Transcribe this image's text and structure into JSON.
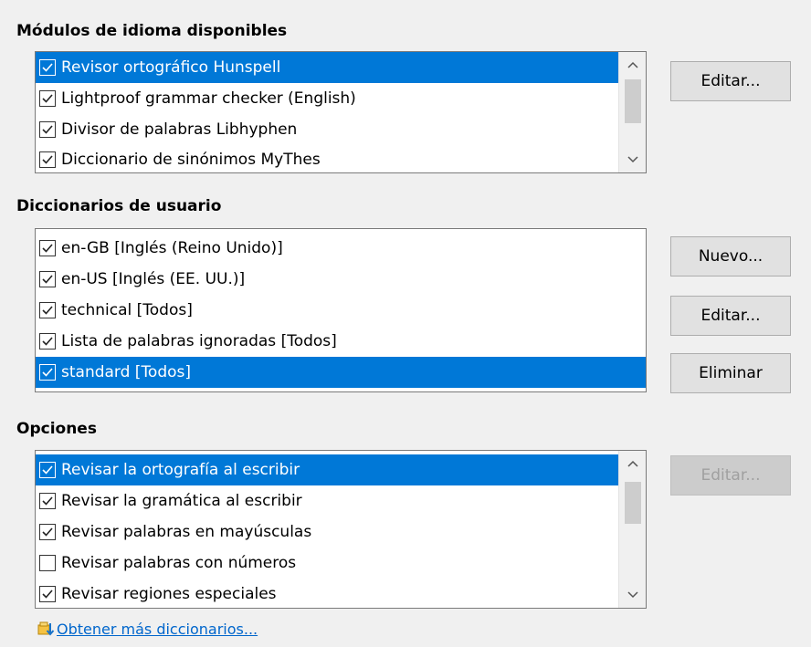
{
  "modules": {
    "title": "Módulos de idioma disponibles",
    "items": [
      {
        "label": "Revisor ortográfico Hunspell",
        "checked": true,
        "selected": true
      },
      {
        "label": "Lightproof grammar checker (English)",
        "checked": true,
        "selected": false
      },
      {
        "label": "Divisor de palabras Libhyphen",
        "checked": true,
        "selected": false
      },
      {
        "label": "Diccionario de sinónimos MyThes",
        "checked": true,
        "selected": false
      }
    ],
    "edit_label": "Editar..."
  },
  "user_dicts": {
    "title": "Diccionarios de usuario",
    "items": [
      {
        "label": "en-GB [Inglés (Reino Unido)]",
        "checked": true,
        "selected": false
      },
      {
        "label": "en-US [Inglés (EE. UU.)]",
        "checked": true,
        "selected": false
      },
      {
        "label": "technical [Todos]",
        "checked": true,
        "selected": false
      },
      {
        "label": "Lista de palabras ignoradas [Todos]",
        "checked": true,
        "selected": false
      },
      {
        "label": "standard [Todos]",
        "checked": true,
        "selected": true
      }
    ],
    "new_label": "Nuevo...",
    "edit_label": "Editar...",
    "delete_label": "Eliminar"
  },
  "options": {
    "title": "Opciones",
    "items": [
      {
        "label": "Revisar la ortografía al escribir",
        "checked": true,
        "selected": true
      },
      {
        "label": "Revisar la gramática al escribir",
        "checked": true,
        "selected": false
      },
      {
        "label": "Revisar palabras en mayúsculas",
        "checked": true,
        "selected": false
      },
      {
        "label": "Revisar palabras con números",
        "checked": false,
        "selected": false
      },
      {
        "label": "Revisar regiones especiales",
        "checked": true,
        "selected": false
      }
    ],
    "edit_label": "Editar..."
  },
  "more_dicts_link": "Obtener más diccionarios...",
  "colors": {
    "selection": "#0078d7",
    "link": "#0066cc"
  }
}
